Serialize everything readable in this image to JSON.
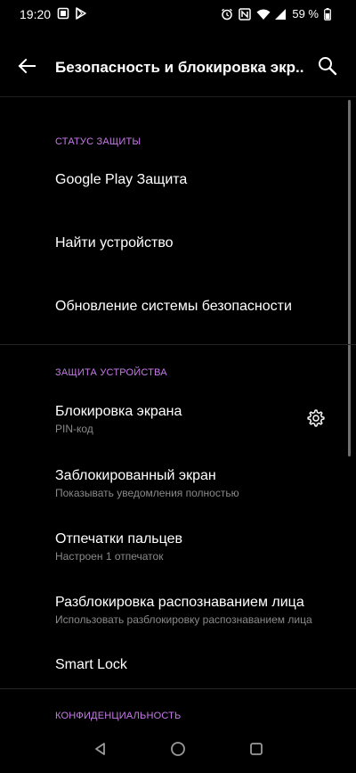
{
  "status_bar": {
    "time": "19:20",
    "battery": "59 %",
    "left_icons": [
      "screenshot-icon",
      "play-store-icon"
    ],
    "right_icons": [
      "alarm-icon",
      "nfc-icon",
      "wifi-icon",
      "signal-icon",
      "battery-icon"
    ]
  },
  "header": {
    "title": "Безопасность и блокировка экр...",
    "back_icon": "arrow-back-icon",
    "search_icon": "search-icon"
  },
  "sections": {
    "status": {
      "header": "СТАТУС ЗАЩИТЫ",
      "items": [
        {
          "title": "Google Play Защита"
        },
        {
          "title": "Найти устройство"
        },
        {
          "title": "Обновление системы безопасности"
        }
      ]
    },
    "device": {
      "header": "ЗАЩИТА УСТРОЙСТВА",
      "items": [
        {
          "title": "Блокировка экрана",
          "subtitle": "PIN-код"
        },
        {
          "title": "Заблокированный экран",
          "subtitle": "Показывать уведомления полностью"
        },
        {
          "title": "Отпечатки пальцев",
          "subtitle": "Настроен 1 отпечаток"
        },
        {
          "title": "Разблокировка распознаванием лица",
          "subtitle": "Использовать разблокировку распознаванием лица"
        },
        {
          "title": "Smart Lock"
        }
      ]
    },
    "privacy": {
      "header": "КОНФИДЕНЦИАЛЬНОСТЬ"
    }
  },
  "colors": {
    "background": "#000000",
    "accent": "#c77ae8",
    "text_primary": "#ffffff",
    "text_secondary": "#8a8a8a"
  },
  "nav_bar": {
    "icons": [
      "nav-back-icon",
      "nav-home-icon",
      "nav-recents-icon"
    ]
  }
}
